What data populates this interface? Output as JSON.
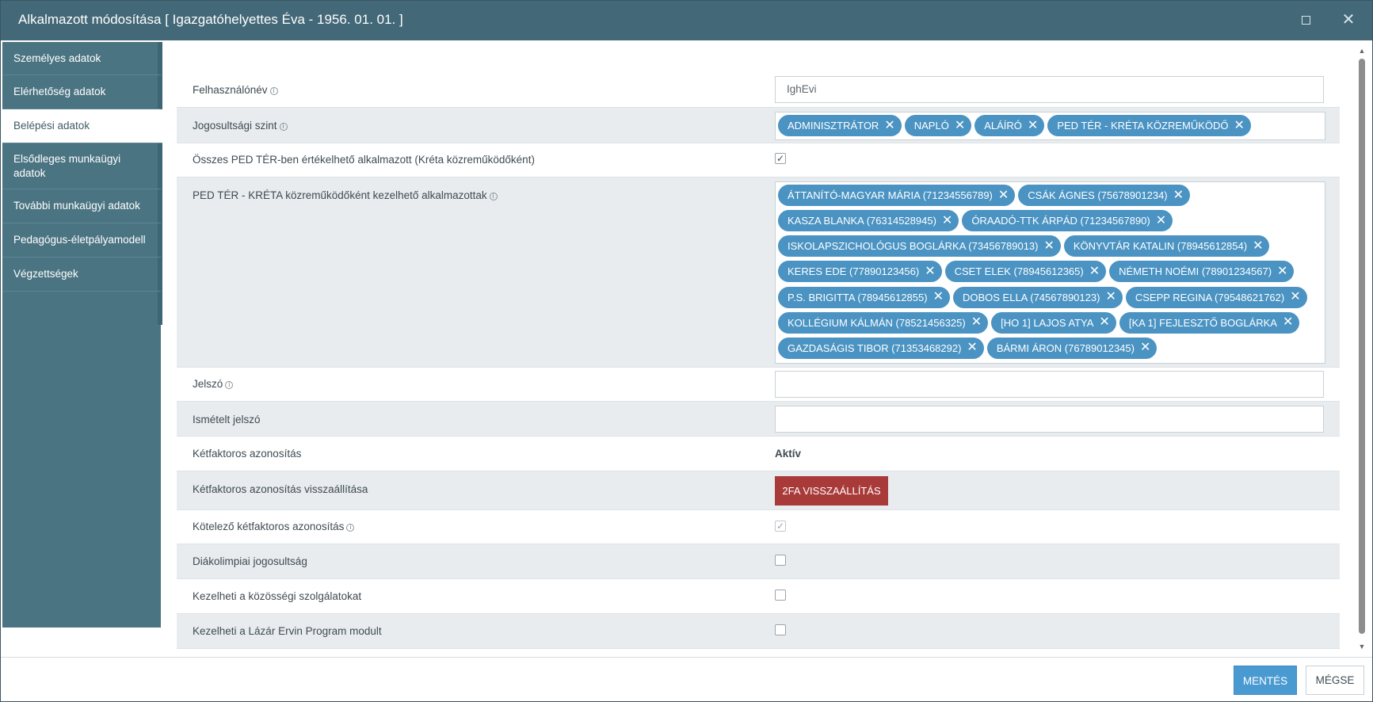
{
  "window": {
    "title": "Alkalmazott módosítása [ Igazgatóhelyettes Éva - 1956. 01. 01. ]",
    "maximize_icon": "maximize-icon",
    "close_icon": "close-icon",
    "close_glyph": "✕"
  },
  "sidebar": {
    "items": [
      {
        "label": "Személyes adatok"
      },
      {
        "label": "Elérhetőség adatok"
      },
      {
        "label": "Belépési adatok"
      },
      {
        "label": "Elsődleges munkaügyi adatok"
      },
      {
        "label": "További munkaügyi adatok"
      },
      {
        "label": "Pedagógus-életpályamodell"
      },
      {
        "label": "Végzettségek"
      }
    ],
    "active_index": 2
  },
  "form": {
    "username": {
      "label": "Felhasználónév",
      "value": "IghEvi"
    },
    "permission_level": {
      "label": "Jogosultsági szint",
      "tags": [
        "ADMINISZTRÁTOR",
        "NAPLÓ",
        "ALÁÍRÓ",
        "PED TÉR - KRÉTA KÖZREMŰKÖDŐ"
      ]
    },
    "all_ped_ter": {
      "label": "Összes PED TÉR-ben értékelhető alkalmazott (Kréta közreműködőként)",
      "checked": true
    },
    "ped_ter_employees": {
      "label": "PED TÉR - KRÉTA közreműködőként kezelhető alkalmazottak",
      "tags": [
        "ÁTTANÍTÓ-MAGYAR MÁRIA (71234556789)",
        "CSÁK ÁGNES (75678901234)",
        "KASZA BLANKA (76314528945)",
        "ÓRAADÓ-TTK ÁRPÁD (71234567890)",
        "ISKOLAPSZICHOLÓGUS BOGLÁRKA (73456789013)",
        "KÖNYVTÁR KATALIN (78945612854)",
        "KERES EDE (77890123456)",
        "CSET ELEK (78945612365)",
        "NÉMETH NOÉMI (78901234567)",
        "P.S. BRIGITTA (78945612855)",
        "DOBOS ELLA (74567890123)",
        "CSEPP REGINA (79548621762)",
        "KOLLÉGIUM KÁLMÁN (78521456325)",
        "[HO 1] LAJOS ATYA",
        "[KA 1] FEJLESZTŐ BOGLÁRKA",
        "GAZDASÁGIS TIBOR (71353468292)",
        "BÁRMI ÁRON (76789012345)"
      ]
    },
    "password": {
      "label": "Jelszó",
      "value": ""
    },
    "password_repeat": {
      "label": "Ismételt jelszó",
      "value": ""
    },
    "two_factor": {
      "label": "Kétfaktoros azonosítás",
      "value": "Aktív"
    },
    "two_factor_reset": {
      "label": "Kétfaktoros azonosítás visszaállítása",
      "button": "2FA VISSZAÁLLÍTÁS"
    },
    "mandatory_2fa": {
      "label": "Kötelező kétfaktoros azonosítás",
      "checked": true
    },
    "diakolimpia": {
      "label": "Diákolimpiai jogosultság",
      "checked": false
    },
    "community_service": {
      "label": "Kezelheti a közösségi szolgálatokat",
      "checked": false
    },
    "lazar_ervin": {
      "label": "Kezelheti a Lázár Ervin Program modult",
      "checked": false
    }
  },
  "footer": {
    "save": "MENTÉS",
    "cancel": "MÉGSE"
  },
  "icons": {
    "info": "info-icon",
    "tag_remove": "remove-tag-icon",
    "check": "checkmark-icon"
  },
  "colors": {
    "header": "#436877",
    "sidebar": "#4b7482",
    "tag": "#4a93c2",
    "danger": "#a93a3a",
    "primary": "#4a9ad2"
  }
}
